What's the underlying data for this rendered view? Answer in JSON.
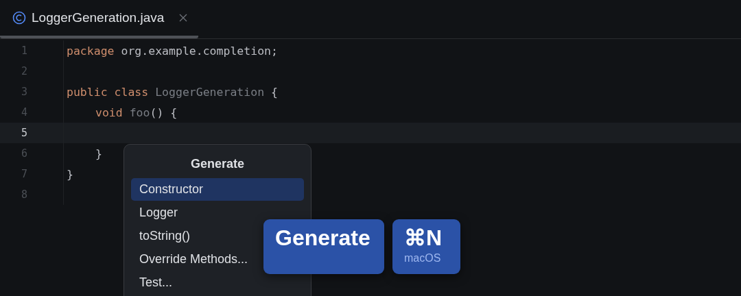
{
  "tabs": [
    {
      "label": "LoggerGeneration.java",
      "selected": true
    }
  ],
  "editor": {
    "lines": [
      {
        "number": "1",
        "current": false,
        "tokens": [
          {
            "kind": "keyword",
            "text": "package"
          },
          {
            "kind": "plain",
            "text": " org.example.completion;"
          }
        ]
      },
      {
        "number": "2",
        "current": false
      },
      {
        "number": "3",
        "current": false,
        "tokens": [
          {
            "kind": "keyword",
            "text": "public class"
          },
          {
            "kind": "name",
            "text": " LoggerGeneration"
          },
          {
            "kind": "plain",
            "text": " {"
          }
        ]
      },
      {
        "number": "4",
        "current": false,
        "indented": true,
        "tokens": [
          {
            "kind": "keyword",
            "text": "void"
          },
          {
            "kind": "name",
            "text": " foo"
          },
          {
            "kind": "plain",
            "text": "() {"
          }
        ]
      },
      {
        "number": "5",
        "current": true
      },
      {
        "number": "6",
        "current": false,
        "indented": true,
        "tokens": [
          {
            "kind": "plain",
            "text": "}"
          }
        ]
      },
      {
        "number": "7",
        "current": false,
        "tokens": [
          {
            "kind": "plain",
            "text": "}"
          }
        ]
      },
      {
        "number": "8",
        "current": false
      }
    ]
  },
  "popup": {
    "title": "Generate",
    "items": [
      {
        "label": "Constructor",
        "selected": true
      },
      {
        "label": "Logger",
        "selected": false
      },
      {
        "label": "toString()",
        "selected": false
      },
      {
        "label": "Override Methods...",
        "selected": false
      },
      {
        "label": "Test...",
        "selected": false
      }
    ]
  },
  "keycaps": [
    {
      "kind": "action",
      "label": "Generate"
    },
    {
      "kind": "shortcut",
      "label": "⌘N",
      "platform": "macOS"
    }
  ]
}
